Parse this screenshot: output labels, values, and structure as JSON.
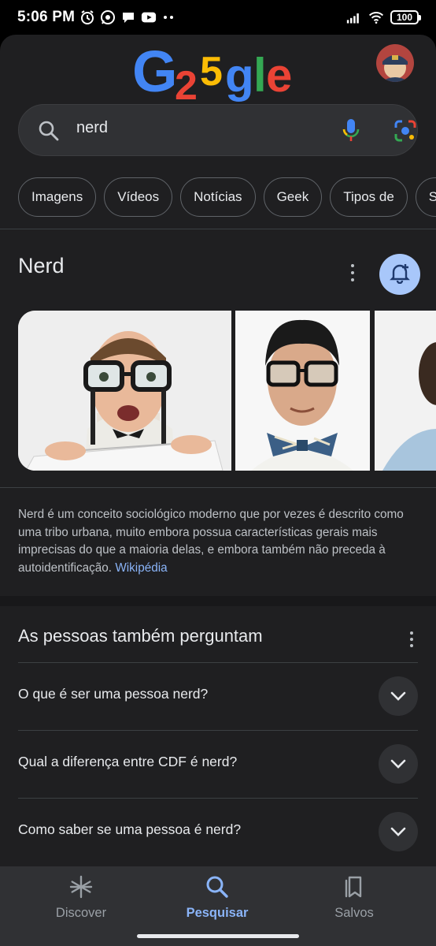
{
  "status_bar": {
    "time": "5:06 PM",
    "battery": "100",
    "icons": [
      "alarm-icon",
      "whatsapp-icon",
      "chat-icon",
      "youtube-icon",
      "more-dots-icon",
      "signal-icon",
      "wifi-icon",
      "battery-icon"
    ]
  },
  "logo": {
    "text_parts": [
      "G",
      "2",
      "5",
      "gle"
    ],
    "colors": [
      "#4285f4",
      "#ea4335",
      "#fbbc05",
      "#4285f4",
      "#34a853",
      "#ea4335"
    ]
  },
  "search": {
    "query": "nerd",
    "icons": [
      "search-icon",
      "mic-icon",
      "lens-icon"
    ]
  },
  "chips": [
    "Imagens",
    "Vídeos",
    "Notícias",
    "Geek",
    "Tipos de",
    "Sinô"
  ],
  "knowledge_panel": {
    "title": "Nerd",
    "description": "Nerd é um conceito sociológico moderno que por vezes é descrito como uma tribo urbana, muito embora possua características gerais mais imprecisas do que a maioria delas, e embora também não preceda à autoidentificação.",
    "source": "Wikipédia"
  },
  "people_also_ask": {
    "title": "As pessoas também perguntam",
    "questions": [
      "O que é ser uma pessoa nerd?",
      "Qual a diferença entre CDF é nerd?",
      "Como saber se uma pessoa é nerd?"
    ]
  },
  "bottom_nav": {
    "items": [
      {
        "label": "Discover",
        "icon": "asterisk-icon"
      },
      {
        "label": "Pesquisar",
        "icon": "search-icon",
        "active": true
      },
      {
        "label": "Salvos",
        "icon": "bookmarks-icon"
      }
    ]
  },
  "colors": {
    "accent": "#8ab4f8",
    "surface": "#1f1f21",
    "chip_border": "#5f6368",
    "bell_bg": "#a8c7fa"
  }
}
